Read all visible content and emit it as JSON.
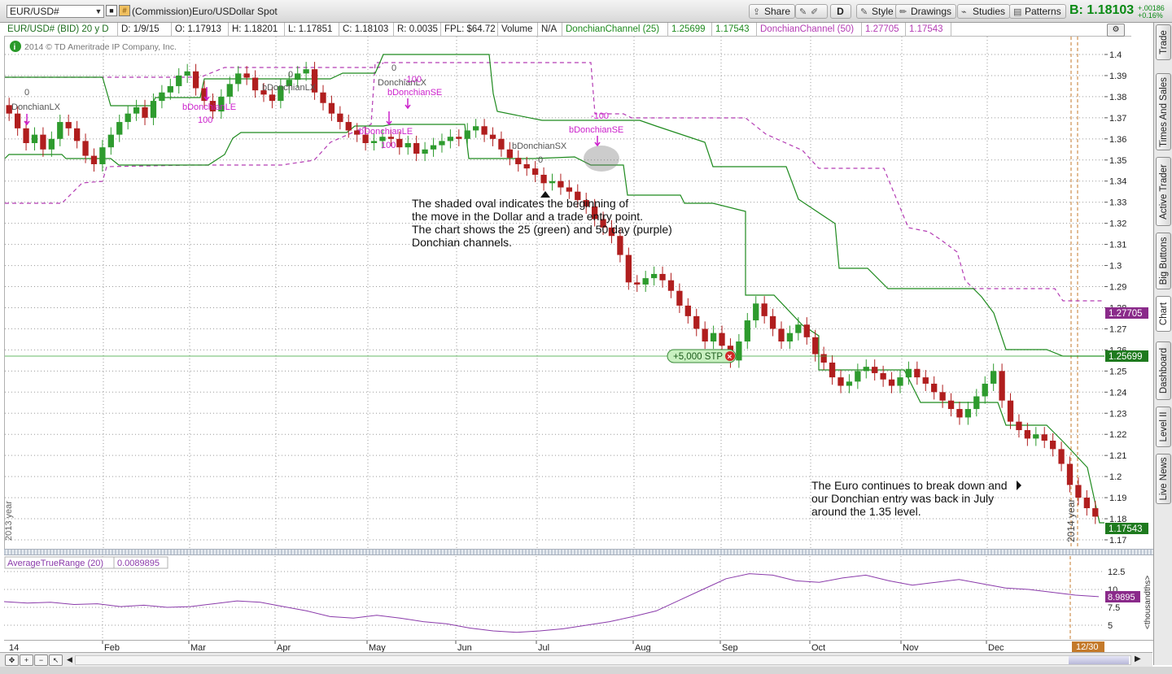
{
  "toolbar": {
    "symbol": "EUR/USD#",
    "symbol_description": "(Commission)Euro/USDollar Spot",
    "buttons": [
      "Share",
      "Style",
      "Drawings",
      "Studies",
      "Patterns"
    ],
    "d_button": "D",
    "share_icon": "share-icon",
    "last_price_prefix": "B:",
    "last_price": "1.18103",
    "change_abs": "+.00186",
    "change_pct": "+0.16%"
  },
  "infobar": {
    "cells": [
      "EUR/USD# (BID) 20 y D",
      "D: 1/9/15",
      "O: 1.17913",
      "H: 1.18201",
      "L: 1.17851",
      "C: 1.18103",
      "R: 0.0035",
      "FPL: $64.72",
      "Volume",
      "N/A",
      "DonchianChannel (25)",
      "1.25699",
      "1.17543",
      "DonchianChannel (50)",
      "1.27705",
      "1.17543"
    ]
  },
  "chart": {
    "copyright": "2014 © TD Ameritrade IP Company, Inc.",
    "price_axis_labels": [
      "1.4",
      "1.39",
      "1.38",
      "1.37",
      "1.36",
      "1.35",
      "1.34",
      "1.33",
      "1.32",
      "1.31",
      "1.3",
      "1.29",
      "1.28",
      "1.27",
      "1.26",
      "1.25",
      "1.24",
      "1.23",
      "1.22",
      "1.21",
      "1.2",
      "1.19",
      "1.18",
      "1.17"
    ],
    "badge_purple": "1.27705",
    "badge_green": "1.25699",
    "badge_price": "1.17543",
    "order_label": "+5,000 STP",
    "annotation_1": [
      "The shaded oval indicates the beginning of",
      "the move in the Dollar and a trade entry point.",
      "The chart shows the 25 (green) and 50 day (purple)",
      "Donchian channels."
    ],
    "annotation_2": [
      "The Euro continues to break down and",
      "our Donchian entry was back in July",
      "around the 1.35 level."
    ],
    "year_left": "2013 year",
    "year_right": "2014 year",
    "signals": [
      {
        "text": "0",
        "color": "#555555"
      },
      {
        "text": "DonchianLX",
        "color": "#555555"
      },
      {
        "text": "bDonchianLE",
        "color": "#cc22cc"
      },
      {
        "text": "100",
        "color": "#cc22cc"
      },
      {
        "text": "0",
        "color": "#555555"
      },
      {
        "text": "bDonchianLX",
        "color": "#555555"
      },
      {
        "text": "0",
        "color": "#555555"
      },
      {
        "text": "DonchianLX",
        "color": "#555555"
      },
      {
        "text": "-100",
        "color": "#cc22cc"
      },
      {
        "text": "bDonchianSE",
        "color": "#cc22cc"
      },
      {
        "text": "bDonchianLE",
        "color": "#cc22cc"
      },
      {
        "text": "100",
        "color": "#cc22cc"
      },
      {
        "text": "bDonchianSX",
        "color": "#555555"
      },
      {
        "text": "0",
        "color": "#555555"
      },
      {
        "text": "-100",
        "color": "#cc22cc"
      },
      {
        "text": "bDonchianSE",
        "color": "#cc22cc"
      }
    ]
  },
  "lower": {
    "study_name": "AverageTrueRange (20)",
    "study_value": "0.0089895",
    "axis_labels": [
      "12.5",
      "10",
      "7.5",
      "5"
    ],
    "badge": "8.9895",
    "units": "<thousandths>"
  },
  "time_axis": {
    "labels": [
      "14",
      "Feb",
      "Mar",
      "Apr",
      "May",
      "Jun",
      "Jul",
      "Aug",
      "Sep",
      "Oct",
      "Nov",
      "Dec"
    ],
    "current_date": "12/30"
  },
  "side_tabs": [
    "Trade",
    "Times And Sales",
    "Active Trader",
    "Big Buttons",
    "Chart",
    "Dashboard",
    "Level II",
    "Live News"
  ],
  "colors": {
    "up": "#2e9b2e",
    "down": "#b01e1e",
    "donchian25": "#1e8a1e",
    "donchian50": "#b43cb4",
    "signal": "#cc22cc"
  },
  "chart_data": {
    "type": "candlestick",
    "symbol": "EUR/USD#",
    "ylim": [
      1.165,
      1.405
    ],
    "series": [
      {
        "name": "DonchianChannel (25)",
        "values": [
          1.25699,
          1.17543
        ]
      },
      {
        "name": "DonchianChannel (50)",
        "values": [
          1.27705,
          1.17543
        ]
      },
      {
        "name": "AverageTrueRange (20)",
        "values": [
          0.0089895
        ]
      }
    ],
    "closes": [
      1.372,
      1.365,
      1.358,
      1.362,
      1.355,
      1.36,
      1.368,
      1.365,
      1.359,
      1.352,
      1.348,
      1.356,
      1.362,
      1.368,
      1.372,
      1.375,
      1.37,
      1.378,
      1.382,
      1.385,
      1.39,
      1.392,
      1.384,
      1.378,
      1.373,
      1.38,
      1.386,
      1.391,
      1.389,
      1.383,
      1.381,
      1.378,
      1.385,
      1.388,
      1.391,
      1.393,
      1.382,
      1.377,
      1.372,
      1.368,
      1.364,
      1.362,
      1.358,
      1.359,
      1.361,
      1.36,
      1.356,
      1.358,
      1.353,
      1.355,
      1.357,
      1.359,
      1.361,
      1.36,
      1.364,
      1.366,
      1.362,
      1.36,
      1.355,
      1.351,
      1.348,
      1.346,
      1.343,
      1.339,
      1.34,
      1.337,
      1.335,
      1.331,
      1.328,
      1.322,
      1.318,
      1.314,
      1.305,
      1.292,
      1.291,
      1.294,
      1.296,
      1.293,
      1.288,
      1.281,
      1.276,
      1.27,
      1.264,
      1.268,
      1.262,
      1.255,
      1.264,
      1.274,
      1.282,
      1.276,
      1.27,
      1.264,
      1.268,
      1.272,
      1.266,
      1.258,
      1.254,
      1.247,
      1.243,
      1.245,
      1.25,
      1.252,
      1.249,
      1.246,
      1.243,
      1.247,
      1.251,
      1.247,
      1.244,
      1.24,
      1.236,
      1.232,
      1.228,
      1.232,
      1.238,
      1.244,
      1.25,
      1.236,
      1.226,
      1.222,
      1.218,
      1.22,
      1.217,
      1.213,
      1.206,
      1.196,
      1.19,
      1.185,
      1.181
    ]
  }
}
